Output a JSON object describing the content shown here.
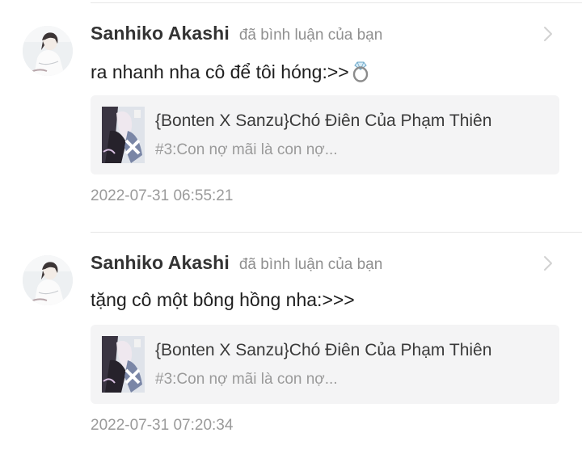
{
  "notifications": [
    {
      "user_name": "Sanhiko Akashi",
      "action": "đã bình luận của bạn",
      "comment": "ra nhanh nha cô để tôi hóng:>>",
      "comment_emoji": "ring-icon",
      "story": {
        "title": "{Bonten X Sanzu}Chó Điên Của Phạm Thiên",
        "chapter": "#3:Con nợ mãi là con nợ..."
      },
      "timestamp": "2022-07-31 06:55:21"
    },
    {
      "user_name": "Sanhiko Akashi",
      "action": "đã bình luận của bạn",
      "comment": "tặng cô một bông hồng nha:>>>",
      "story": {
        "title": "{Bonten X Sanzu}Chó Điên Của Phạm Thiên",
        "chapter": "#3:Con nợ mãi là con nợ..."
      },
      "timestamp": "2022-07-31 07:20:34"
    }
  ],
  "icons": {
    "chevron": "chevron-right-icon",
    "avatar": "avatar",
    "cover": "story-cover-thumbnail"
  },
  "colors": {
    "name_text": "#333333",
    "secondary_text": "#8f8f8f",
    "card_background": "#f4f4f5",
    "divider": "#e6e6e6"
  }
}
